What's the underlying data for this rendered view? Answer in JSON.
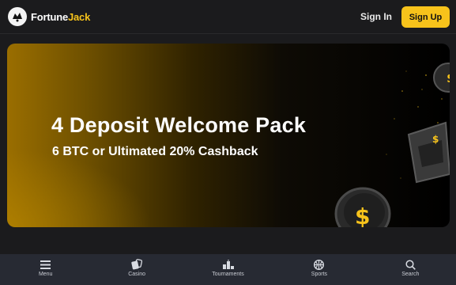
{
  "header": {
    "logo_text_primary": "Fortune",
    "logo_text_accent": "Jack",
    "signin_label": "Sign In",
    "signup_label": "Sign Up"
  },
  "hero": {
    "title": "4 Deposit Welcome Pack",
    "subtitle": "6 BTC or Ultimated 20% Cashback"
  },
  "bottom_nav": {
    "items": [
      {
        "label": "Menu",
        "icon": "menu-icon"
      },
      {
        "label": "Casino",
        "icon": "casino-icon"
      },
      {
        "label": "Tournaments",
        "icon": "tournaments-icon"
      },
      {
        "label": "Sports",
        "icon": "sports-icon"
      },
      {
        "label": "Search",
        "icon": "search-icon"
      }
    ]
  },
  "colors": {
    "accent": "#f7c31b",
    "background": "#1b1b1d",
    "nav_background": "#272a33"
  }
}
